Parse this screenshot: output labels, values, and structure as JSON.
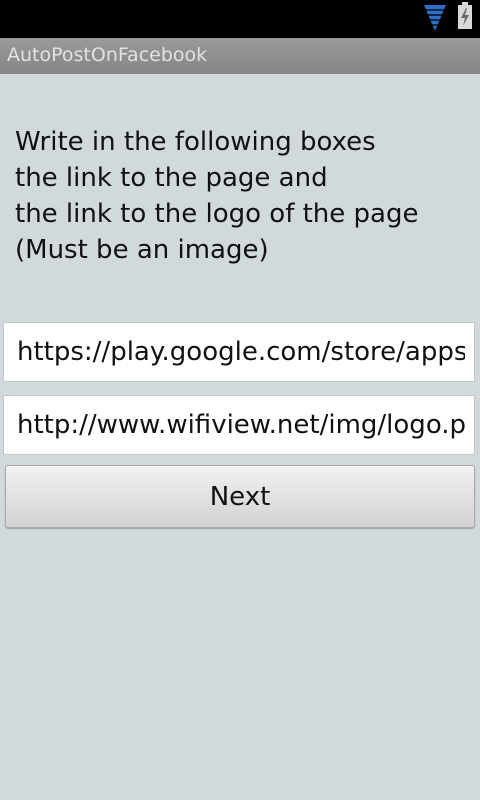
{
  "status_bar": {
    "icons": [
      "signal-icon",
      "battery-icon"
    ],
    "signal_color": "#3a7bd5"
  },
  "app": {
    "title": "AutoPostOnFacebook"
  },
  "instructions": {
    "lines": [
      "Write in the following boxes",
      "the link to the page and",
      "the link to the logo of the page",
      "(Must be an image)"
    ]
  },
  "fields": {
    "page_link": {
      "value": "https://play.google.com/store/apps/details?id=com.wifiview"
    },
    "logo_link": {
      "value": "http://www.wifiview.net/img/logo.png"
    }
  },
  "buttons": {
    "next_label": "Next"
  },
  "colors": {
    "background": "#d1d9dc",
    "title_bar": "#8f8f8f",
    "status_bar": "#000000"
  }
}
